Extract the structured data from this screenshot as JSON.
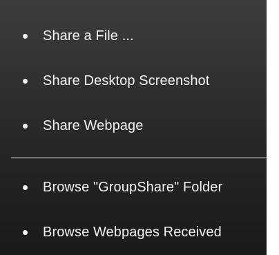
{
  "menu": {
    "items": [
      {
        "label": "Share a File ..."
      },
      {
        "label": "Share Desktop Screenshot"
      },
      {
        "label": "Share Webpage"
      },
      {
        "label": "Browse \"GroupShare\" Folder"
      },
      {
        "label": "Browse Webpages Received"
      }
    ]
  },
  "colors": {
    "background_top": "#3d3d3d",
    "background_bottom": "#1a1a1a",
    "text": "#f2f2f2",
    "divider": "#e6e6e6"
  }
}
